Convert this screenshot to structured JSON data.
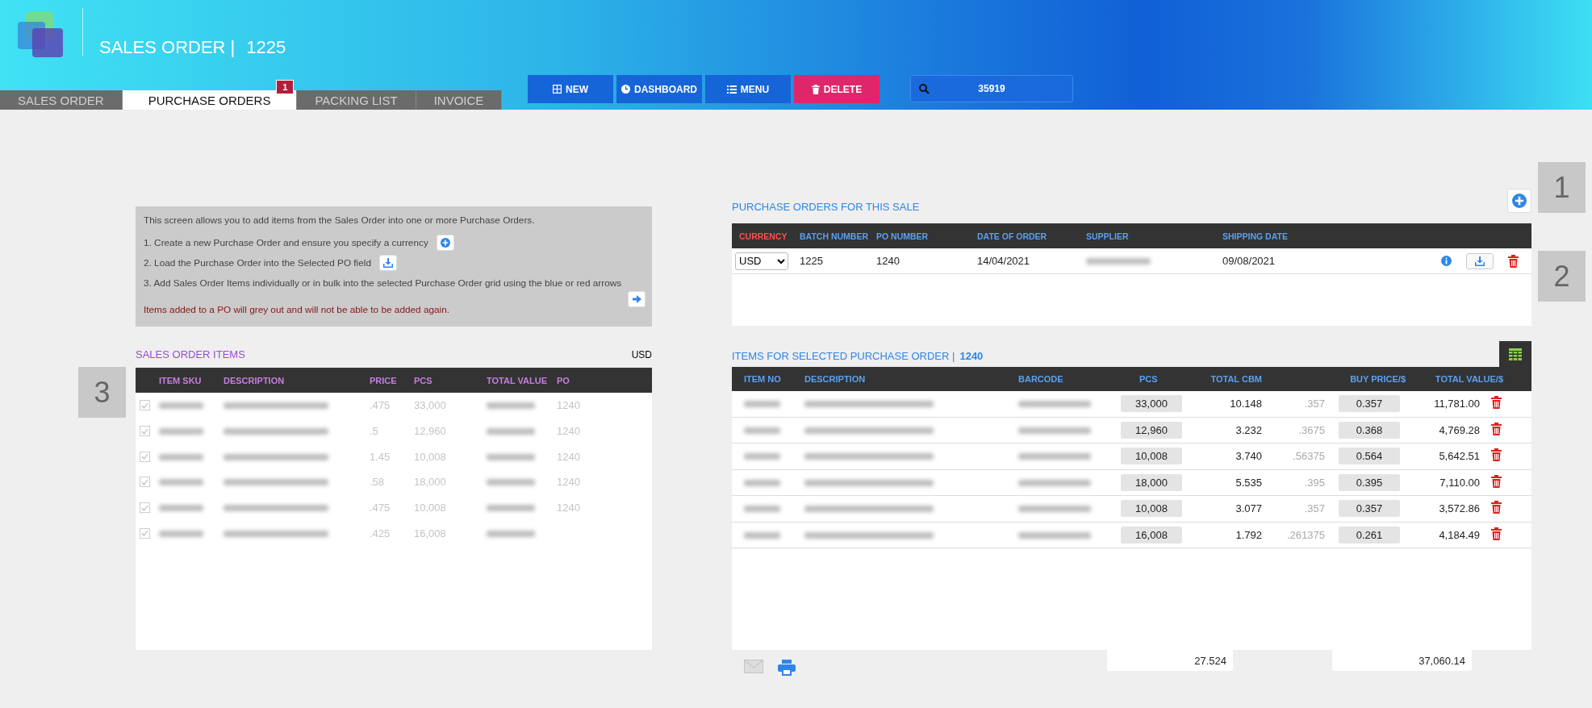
{
  "header": {
    "title": "SALES ORDER |",
    "order_number": "1225"
  },
  "tabs": [
    {
      "label": "SALES ORDER",
      "selected": false
    },
    {
      "label": "PURCHASE ORDERS",
      "selected": true,
      "badge": "1"
    },
    {
      "label": "PACKING LIST",
      "selected": false
    },
    {
      "label": "INVOICE",
      "selected": false
    }
  ],
  "toolbar": [
    {
      "label": "NEW",
      "kind": "new"
    },
    {
      "label": "DASHBOARD",
      "kind": "dashboard"
    },
    {
      "label": "MENU",
      "kind": "menu"
    },
    {
      "label": "DELETE",
      "kind": "delete"
    }
  ],
  "search": {
    "value": "35919"
  },
  "instructions": {
    "intro": "This screen allows you to add items from the Sales Order into one or more Purchase Orders.",
    "steps": [
      {
        "text": "1. Create a new Purchase Order and ensure you specify a currency",
        "kind": "add"
      },
      {
        "text": "2. Load the Purchase Order into the Selected PO field",
        "kind": "load"
      },
      {
        "text": "3. Add Sales Order Items individually or in bulk into the selected Purchase Order grid using the blue or red arrows"
      }
    ],
    "note": "Items added to a PO will grey out and will not be able to be added again."
  },
  "sales_order_items": {
    "title": "SALES ORDER ITEMS",
    "currency": "USD",
    "marker": "3",
    "columns": [
      "ITEM SKU",
      "DESCRIPTION",
      "PRICE",
      "PCS",
      "TOTAL VALUE",
      "PO"
    ],
    "rows": [
      {
        "checked": true,
        "price": ".475",
        "pcs": "33,000",
        "po": "1240"
      },
      {
        "checked": true,
        "price": ".5",
        "pcs": "12,960",
        "po": "1240"
      },
      {
        "checked": true,
        "price": "1.45",
        "pcs": "10,008",
        "po": "1240"
      },
      {
        "checked": true,
        "price": ".58",
        "pcs": "18,000",
        "po": "1240"
      },
      {
        "checked": true,
        "price": ".475",
        "pcs": "10,008",
        "po": "1240"
      },
      {
        "checked": true,
        "price": ".425",
        "pcs": "16,008"
      }
    ]
  },
  "purchase_orders": {
    "title": "PURCHASE ORDERS FOR THIS SALE",
    "columns": [
      {
        "label": "CURRENCY",
        "required": true
      },
      {
        "label": "BATCH NUMBER",
        "required": false
      },
      {
        "label": "PO NUMBER",
        "required": false
      },
      {
        "label": "DATE OF ORDER",
        "required": false
      },
      {
        "label": "SUPPLIER",
        "required": false
      },
      {
        "label": "SHIPPING DATE",
        "required": false
      }
    ],
    "rows": [
      {
        "currency": "USD",
        "batch_number": "1225",
        "po_number": "1240",
        "date_of_order": "14/04/2021",
        "shipping_date": "09/08/2021"
      }
    ]
  },
  "markers": [
    "1",
    "2"
  ],
  "selected_po_items": {
    "title": "ITEMS FOR SELECTED PURCHASE ORDER |",
    "po_number": "1240",
    "columns": [
      "ITEM NO",
      "DESCRIPTION",
      "BARCODE",
      "PCS",
      "TOTAL CBM",
      "BUY PRICE/$",
      "TOTAL VALUE/$"
    ],
    "rows": [
      {
        "pcs": "33,000",
        "total_cbm": "10.148",
        "unit_price": ".357",
        "buy_price": "0.357",
        "total_value": "11,781.00"
      },
      {
        "pcs": "12,960",
        "total_cbm": "3.232",
        "unit_price": ".3675",
        "buy_price": "0.368",
        "total_value": "4,769.28"
      },
      {
        "pcs": "10,008",
        "total_cbm": "3.740",
        "unit_price": ".56375",
        "buy_price": "0.564",
        "total_value": "5,642.51"
      },
      {
        "pcs": "18,000",
        "total_cbm": "5.535",
        "unit_price": ".395",
        "buy_price": "0.395",
        "total_value": "7,110.00"
      },
      {
        "pcs": "10,008",
        "total_cbm": "3.077",
        "unit_price": ".357",
        "buy_price": "0.357",
        "total_value": "3,572.86"
      },
      {
        "pcs": "16,008",
        "total_cbm": "1.792",
        "unit_price": ".261375",
        "buy_price": "0.261",
        "total_value": "4,184.49"
      }
    ],
    "totals": {
      "total_cbm": "27.524",
      "total_value": "37,060.14"
    }
  }
}
